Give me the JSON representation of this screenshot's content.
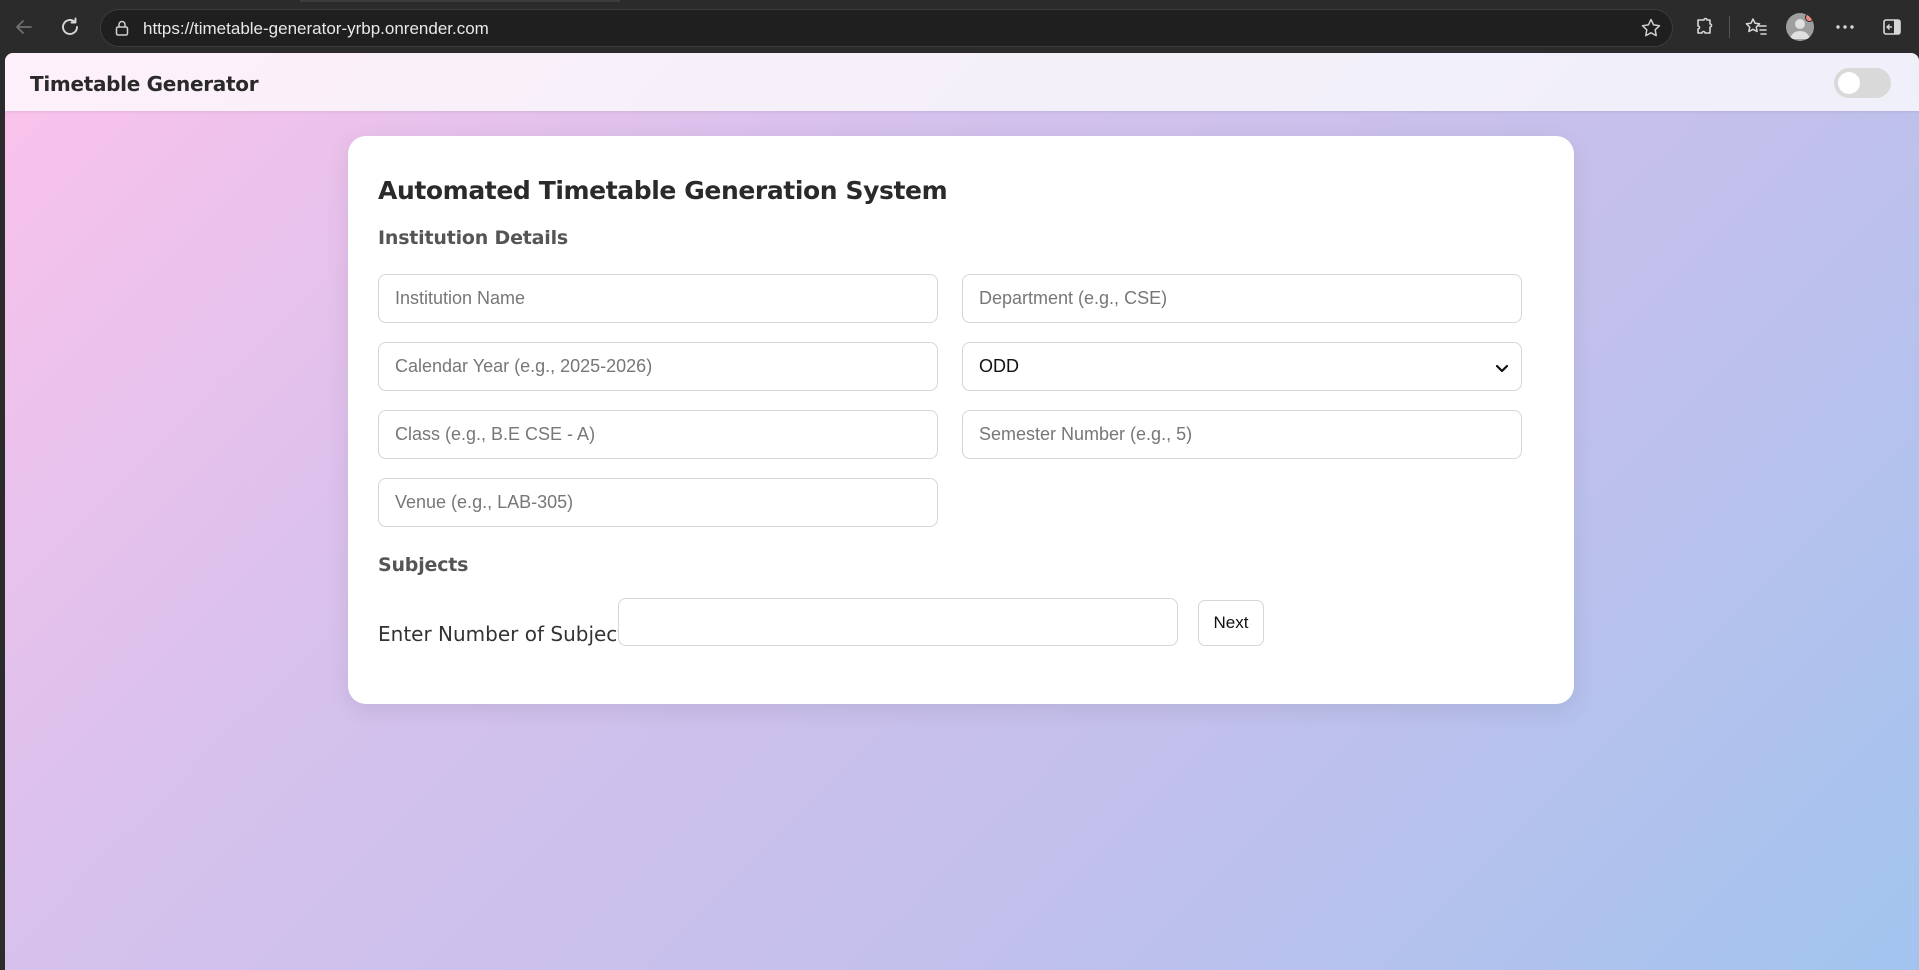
{
  "browser": {
    "url": "https://timetable-generator-yrbp.onrender.com",
    "icons": [
      "back-icon",
      "reload-icon",
      "lock-icon",
      "star-icon",
      "extensions-icon",
      "favorites-icon",
      "profile-avatar",
      "more-icon",
      "sidebar-icon"
    ]
  },
  "appbar": {
    "brand": "Timetable Generator"
  },
  "form": {
    "title": "Automated Timetable Generation System",
    "institution_section": "Institution Details",
    "fields": {
      "institution_name": {
        "placeholder": "Institution Name",
        "value": ""
      },
      "department": {
        "placeholder": "Department (e.g., CSE)",
        "value": ""
      },
      "calendar_year": {
        "placeholder": "Calendar Year (e.g., 2025-2026)",
        "value": ""
      },
      "semester_type": {
        "selected": "ODD"
      },
      "class": {
        "placeholder": "Class (e.g., B.E CSE - A)",
        "value": ""
      },
      "semester_number": {
        "placeholder": "Semester Number (e.g., 5)",
        "value": ""
      },
      "venue": {
        "placeholder": "Venue (e.g., LAB-305)",
        "value": ""
      }
    },
    "subjects_section": "Subjects",
    "subjects_count_label": "Enter Number of Subjects:",
    "subjects_count_value": "",
    "next_label": "Next"
  },
  "colors": {
    "gradient_start": "#fbc2eb",
    "gradient_end": "#a1c4ee",
    "card": "#ffffff"
  }
}
